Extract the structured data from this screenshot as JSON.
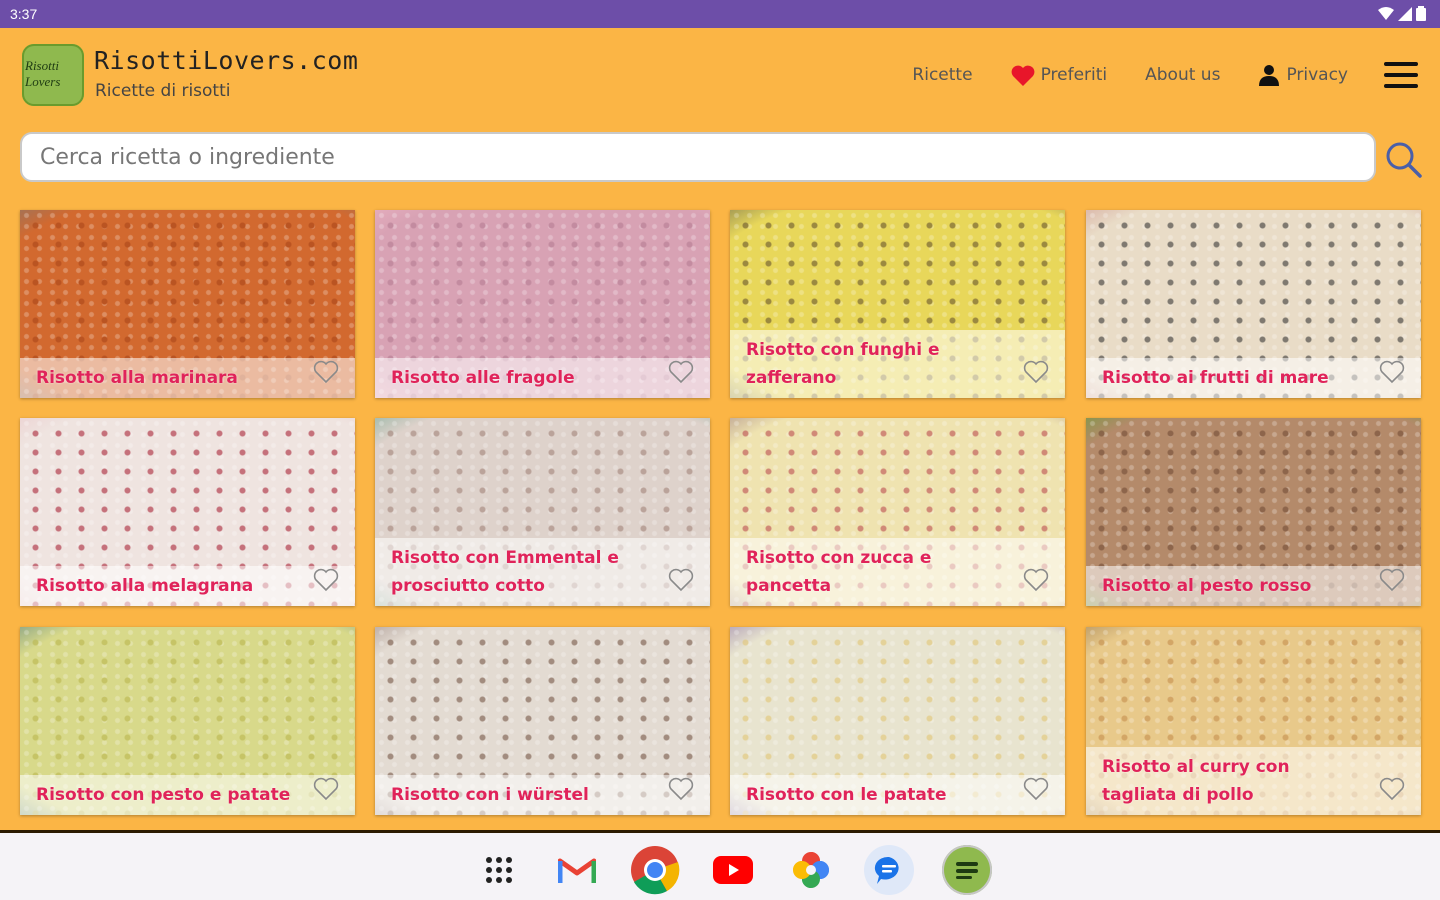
{
  "status": {
    "time": "3:37"
  },
  "header": {
    "title": "RisottiLovers.com",
    "subtitle": "Ricette di risotti",
    "logo_text": [
      "Risotti",
      "Lovers"
    ],
    "nav": {
      "recipes": "Ricette",
      "favorites": "Preferiti",
      "about": "About us",
      "privacy": "Privacy"
    }
  },
  "search": {
    "placeholder": "Cerca ricetta o ingrediente"
  },
  "recipes": [
    {
      "name": "Risotto alla marinara",
      "base": "#d2692f",
      "accent": "#a84418",
      "plate": "#6a7f86"
    },
    {
      "name": "Risotto alle fragole",
      "base": "#d8a2b4",
      "accent": "#b27a90",
      "plate": "#f2b8c6"
    },
    {
      "name": "Risotto con funghi e zafferano",
      "base": "#e8d75a",
      "accent": "#5e4a2c",
      "plate": "#4f4f4f"
    },
    {
      "name": "Risotto ai frutti di mare",
      "base": "#e9dcc7",
      "accent": "#2a2a2a",
      "plate": "#c98a86"
    },
    {
      "name": "Risotto alla melagrana",
      "base": "#efe4e0",
      "accent": "#a3152a",
      "plate": "#e9c1c5"
    },
    {
      "name": "Risotto con Emmental e prosciutto cotto",
      "base": "#ded2cb",
      "accent": "#9d7d73",
      "plate": "#5c9e86"
    },
    {
      "name": "Risotto con zucca e pancetta",
      "base": "#efe3b0",
      "accent": "#b7404a",
      "plate": "#8f6a7a"
    },
    {
      "name": "Risotto al pesto rosso",
      "base": "#b48a6a",
      "accent": "#6e4733",
      "plate": "#4fa52a"
    },
    {
      "name": "Risotto con pesto e patate",
      "base": "#d8d98a",
      "accent": "#b8b44a",
      "plate": "#3d6d84"
    },
    {
      "name": "Risotto con i würstel",
      "base": "#e3dbd2",
      "accent": "#6e4d3c",
      "plate": "#8b7570"
    },
    {
      "name": "Risotto con le patate",
      "base": "#e8e4cf",
      "accent": "#e2c46e",
      "plate": "#7c5ea0"
    },
    {
      "name": "Risotto al curry con tagliata di pollo",
      "base": "#e8c98a",
      "accent": "#c28a49",
      "plate": "#8b6a42"
    }
  ],
  "colors": {
    "status_bar": "#6d4ea8",
    "background": "#fbb545",
    "caption_text": "#e0235a",
    "heart": "#e8162a"
  }
}
